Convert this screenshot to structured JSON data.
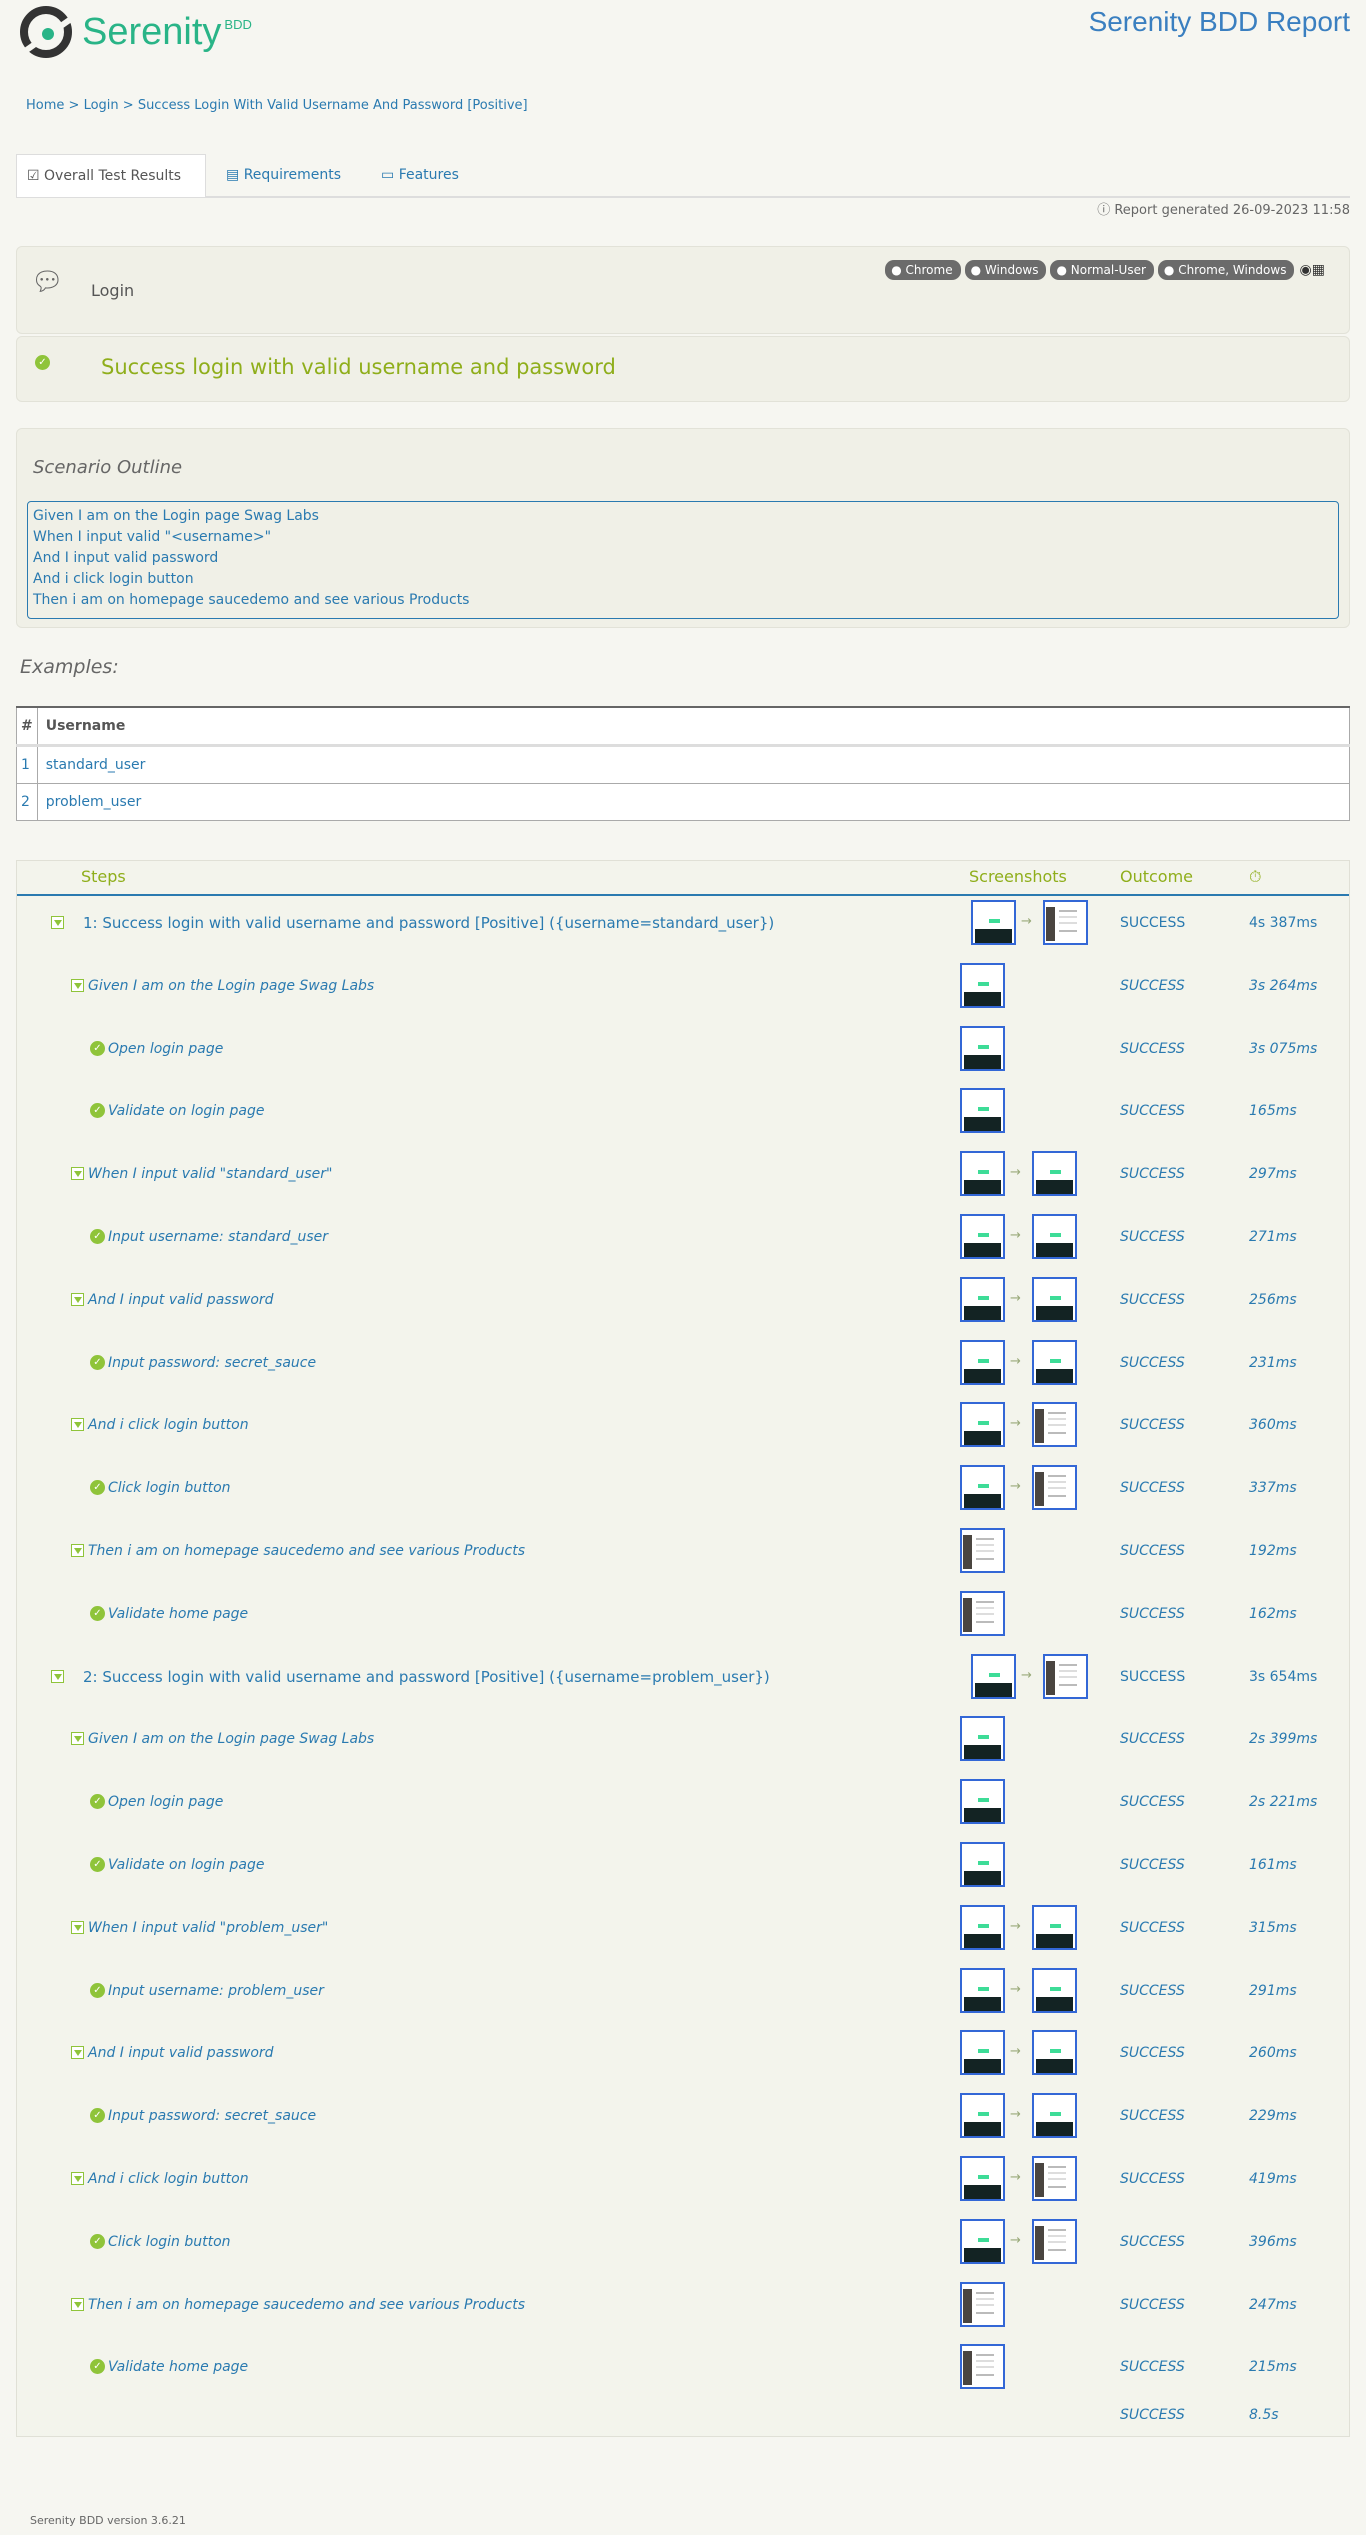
{
  "header": {
    "logo_text": "Serenity",
    "logo_sub": "BDD",
    "report_title": "Serenity BDD Report"
  },
  "breadcrumb": [
    "Home",
    "Login",
    "Success Login With Valid Username And Password [Positive]"
  ],
  "tabs": [
    {
      "label": "Overall Test Results",
      "icon": "checklist-icon",
      "active": true
    },
    {
      "label": "Requirements",
      "icon": "list-icon"
    },
    {
      "label": "Features",
      "icon": "comment-icon"
    }
  ],
  "report_generated": "Report generated 26-09-2023 11:58",
  "feature": {
    "name": "Login",
    "tags": [
      "Chrome",
      "Windows",
      "Normal-User",
      "Chrome, Windows"
    ],
    "platform_icons": [
      "chrome-icon",
      "windows-icon"
    ]
  },
  "scenario_title": "Success login with valid username and password",
  "outline": {
    "title": "Scenario Outline",
    "lines": [
      "Given I am on the Login page Swag Labs",
      "When I input valid \"<username>\"",
      "And I input valid password",
      "And i click login button",
      "Then i am on homepage saucedemo and see various Products"
    ]
  },
  "examples": {
    "title": "Examples:",
    "headers": [
      "#",
      "Username"
    ],
    "rows": [
      [
        "1",
        "standard_user"
      ],
      [
        "2",
        "problem_user"
      ]
    ]
  },
  "steps_table": {
    "headers": {
      "steps": "Steps",
      "screenshots": "Screenshots",
      "outcome": "Outcome",
      "duration_icon": "stopwatch-icon"
    },
    "colors": {
      "success": "#8fc43a",
      "link": "#2a7ab0"
    },
    "rows": [
      {
        "level": 1,
        "text": "1: Success login with valid username and password [Positive] ({username=standard_user})",
        "shots": [
          "login",
          "home"
        ],
        "outcome": "SUCCESS",
        "duration": "4s 387ms"
      },
      {
        "level": 2,
        "text": "Given I am on the Login page Swag Labs",
        "shots": [
          "login"
        ],
        "outcome": "SUCCESS",
        "duration": "3s 264ms"
      },
      {
        "level": 3,
        "text": "Open login page",
        "shots": [
          "login"
        ],
        "outcome": "SUCCESS",
        "duration": "3s 075ms"
      },
      {
        "level": 3,
        "text": "Validate on login page",
        "shots": [
          "login"
        ],
        "outcome": "SUCCESS",
        "duration": "165ms"
      },
      {
        "level": 2,
        "text": "When I input valid \"standard_user\"",
        "shots": [
          "login",
          "login"
        ],
        "outcome": "SUCCESS",
        "duration": "297ms"
      },
      {
        "level": 3,
        "text": "Input username: standard_user",
        "shots": [
          "login",
          "login"
        ],
        "outcome": "SUCCESS",
        "duration": "271ms"
      },
      {
        "level": 2,
        "text": "And I input valid password",
        "shots": [
          "login",
          "login"
        ],
        "outcome": "SUCCESS",
        "duration": "256ms"
      },
      {
        "level": 3,
        "text": "Input password: secret_sauce",
        "shots": [
          "login",
          "login"
        ],
        "outcome": "SUCCESS",
        "duration": "231ms"
      },
      {
        "level": 2,
        "text": "And i click login button",
        "shots": [
          "login",
          "home"
        ],
        "outcome": "SUCCESS",
        "duration": "360ms"
      },
      {
        "level": 3,
        "text": "Click login button",
        "shots": [
          "login",
          "home"
        ],
        "outcome": "SUCCESS",
        "duration": "337ms"
      },
      {
        "level": 2,
        "text": "Then i am on homepage saucedemo and see various Products",
        "shots": [
          "home"
        ],
        "outcome": "SUCCESS",
        "duration": "192ms"
      },
      {
        "level": 3,
        "text": "Validate home page",
        "shots": [
          "home"
        ],
        "outcome": "SUCCESS",
        "duration": "162ms"
      },
      {
        "level": 1,
        "text": "2: Success login with valid username and password [Positive] ({username=problem_user})",
        "shots": [
          "login",
          "home"
        ],
        "outcome": "SUCCESS",
        "duration": "3s 654ms"
      },
      {
        "level": 2,
        "text": "Given I am on the Login page Swag Labs",
        "shots": [
          "login"
        ],
        "outcome": "SUCCESS",
        "duration": "2s 399ms"
      },
      {
        "level": 3,
        "text": "Open login page",
        "shots": [
          "login"
        ],
        "outcome": "SUCCESS",
        "duration": "2s 221ms"
      },
      {
        "level": 3,
        "text": "Validate on login page",
        "shots": [
          "login"
        ],
        "outcome": "SUCCESS",
        "duration": "161ms"
      },
      {
        "level": 2,
        "text": "When I input valid \"problem_user\"",
        "shots": [
          "login",
          "login"
        ],
        "outcome": "SUCCESS",
        "duration": "315ms"
      },
      {
        "level": 3,
        "text": "Input username: problem_user",
        "shots": [
          "login",
          "login"
        ],
        "outcome": "SUCCESS",
        "duration": "291ms"
      },
      {
        "level": 2,
        "text": "And I input valid password",
        "shots": [
          "login",
          "login"
        ],
        "outcome": "SUCCESS",
        "duration": "260ms"
      },
      {
        "level": 3,
        "text": "Input password: secret_sauce",
        "shots": [
          "login",
          "login"
        ],
        "outcome": "SUCCESS",
        "duration": "229ms"
      },
      {
        "level": 2,
        "text": "And i click login button",
        "shots": [
          "login",
          "home"
        ],
        "outcome": "SUCCESS",
        "duration": "419ms"
      },
      {
        "level": 3,
        "text": "Click login button",
        "shots": [
          "login",
          "home"
        ],
        "outcome": "SUCCESS",
        "duration": "396ms"
      },
      {
        "level": 2,
        "text": "Then i am on homepage saucedemo and see various Products",
        "shots": [
          "home"
        ],
        "outcome": "SUCCESS",
        "duration": "247ms"
      },
      {
        "level": 3,
        "text": "Validate home page",
        "shots": [
          "home"
        ],
        "outcome": "SUCCESS",
        "duration": "215ms"
      }
    ],
    "total": {
      "outcome": "SUCCESS",
      "duration": "8.5s"
    }
  },
  "footer": "Serenity BDD version 3.6.21"
}
